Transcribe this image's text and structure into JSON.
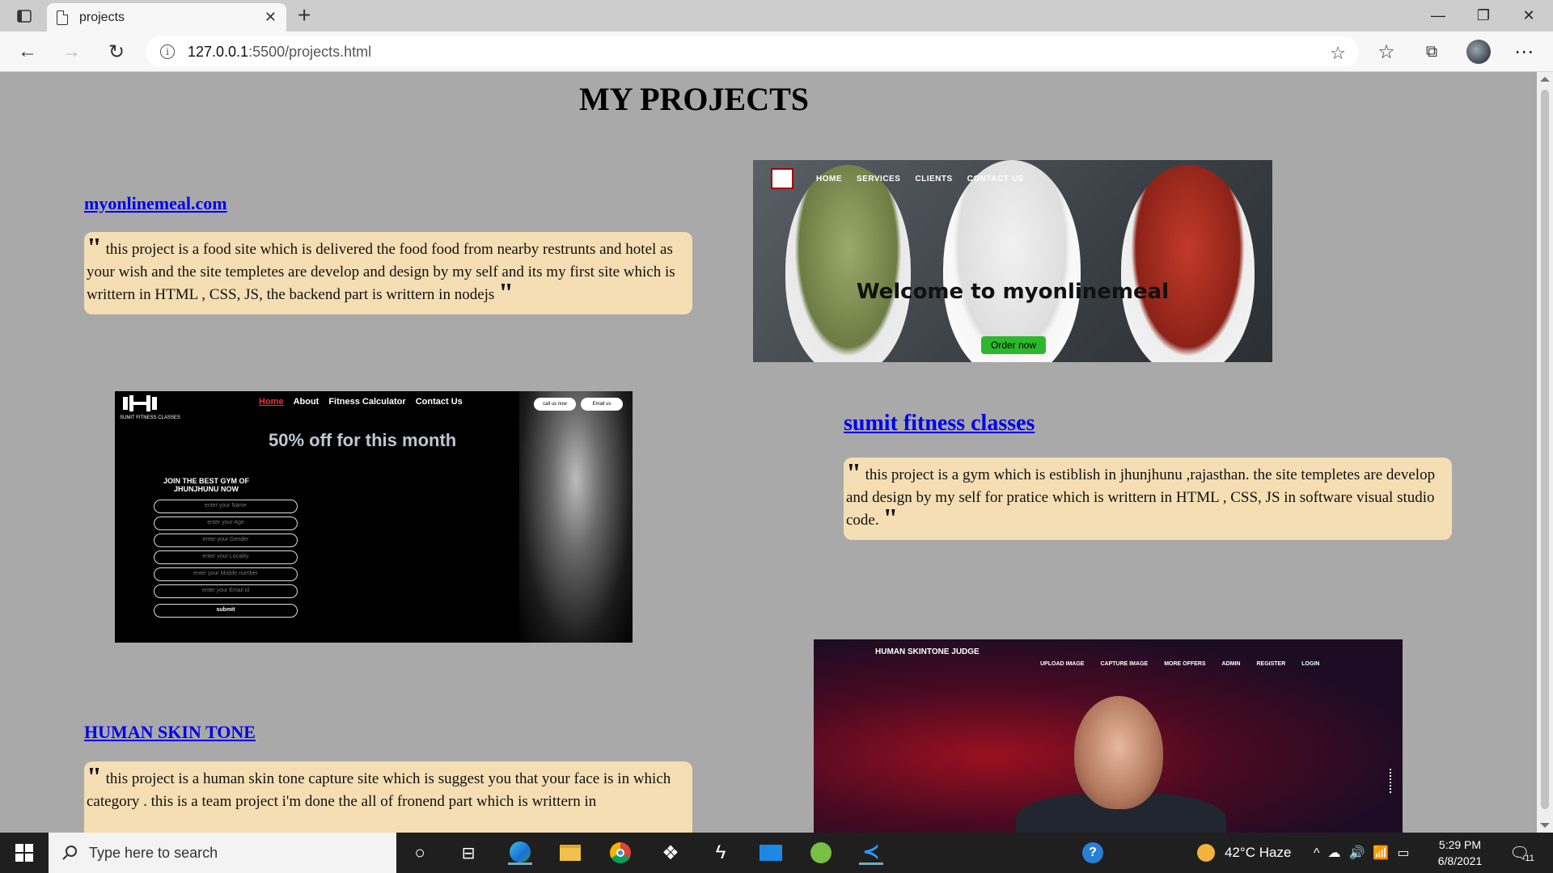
{
  "browser": {
    "tab_title": "projects",
    "url_host": "127.0.0.1",
    "url_path": ":5500/projects.html"
  },
  "page": {
    "title": "MY PROJECTS"
  },
  "projects": [
    {
      "link": "myonlinemeal.com",
      "description": "this project is a food site which is delivered the food food from nearby restrunts and hotel as your wish and the site templetes are develop and design by my self and its my first site which is writtern in HTML , CSS, JS, the backend part is writtern in nodejs"
    },
    {
      "link": "sumit fitness classes",
      "description": "this project is a gym which is estiblish in jhunjhunu ,rajasthan. the site templetes are develop and design by my self for pratice which is writtern in HTML , CSS, JS in software visual studio code."
    },
    {
      "link": "HUMAN SKIN TONE",
      "description": "this project is a human skin tone capture site which is suggest you that your face is in which category . this is a team project i'm done the all of fronend part which is writtern in"
    }
  ],
  "shots": {
    "meal": {
      "nav": [
        "HOME",
        "SERVICES",
        "CLIENTS",
        "CONTACT US"
      ],
      "headline": "Welcome to myonlinemeal",
      "order_button": "Order now"
    },
    "gym": {
      "nav": [
        "Home",
        "About",
        "Fitness Calculator",
        "Contact Us"
      ],
      "brand": "SUMIT FITNESS CLASSES",
      "call_button": "call us now",
      "email_button": "Email us",
      "offer": "50% off for this month",
      "join": "JOIN THE BEST GYM OF JHUNJHUNU NOW",
      "fields": [
        "enter your Name",
        "enter your Age",
        "enter your Gender",
        "enter your Locality",
        "enter your Mobile number",
        "enter your Email id"
      ],
      "submit": "submit"
    },
    "skin": {
      "brand": "HUMAN SKINTONE  JUDGE",
      "menu": [
        "UPLOAD IMAGE",
        "CAPTURE IMAGE",
        "MORE OFFERS",
        "ADMIN",
        "REGISTER",
        "LOGIN"
      ]
    }
  },
  "taskbar": {
    "search_placeholder": "Type here to search",
    "weather": "42°C  Haze",
    "time": "5:29 PM",
    "date": "6/8/2021",
    "notifications": "11"
  },
  "colors": {
    "page_bg": "#a9a9a9",
    "desc_bg": "#f5deb3",
    "link": "#0000ee"
  }
}
